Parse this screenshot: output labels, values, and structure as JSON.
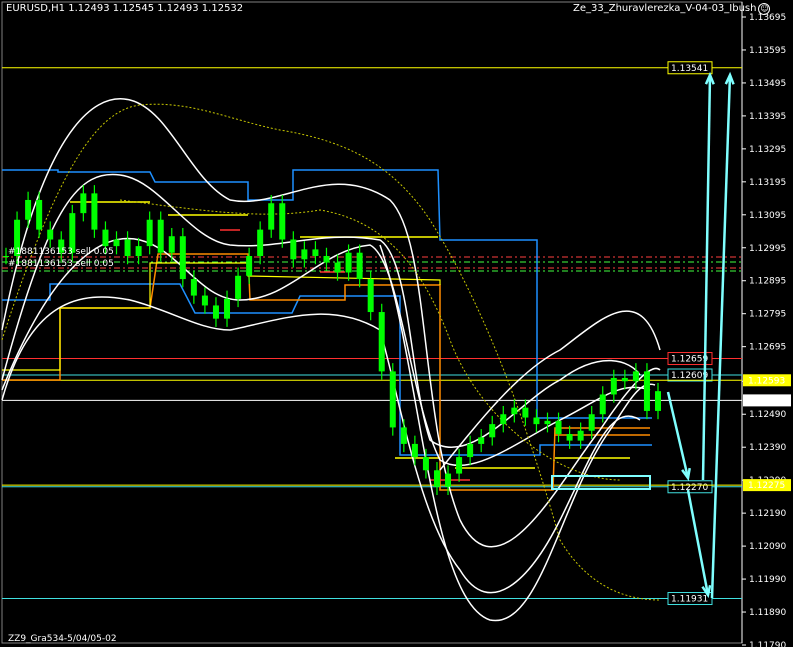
{
  "header": {
    "symbol": "EURUSD,H1",
    "ohlc": "1.12493 1.12545 1.12493 1.12532",
    "expert": "Ze_33_Zhuravlerezka_V-04-03_Ibush",
    "smiley_icon": "smiley-icon"
  },
  "footer": {
    "label": "ZZ9_Gra534-5/04/05-02"
  },
  "orders": [
    {
      "text": "#1881136153 sell 0.05"
    },
    {
      "text": "#1881136153 sell 0.05"
    }
  ],
  "colors": {
    "background": "#000000",
    "candles": "#00ff00",
    "bands": "#ffffff",
    "channel_blue": "#1e90ff",
    "channel_orange": "#ff8c00",
    "yellow": "#ffff00",
    "arrows": "#7fffff",
    "red_level": "#ff3030",
    "grid_cyan": "#40e0e0"
  },
  "chart_data": {
    "type": "line",
    "title": "",
    "price_axis": {
      "ticks": [
        "1.13695",
        "1.13595",
        "1.13495",
        "1.13395",
        "1.13295",
        "1.13195",
        "1.13095",
        "1.12995",
        "1.12895",
        "1.12795",
        "1.12695",
        "1.12590",
        "1.12490",
        "1.12390",
        "1.12290",
        "1.12190",
        "1.12090",
        "1.11990",
        "1.11890",
        "1.11790"
      ],
      "ylim": [
        1.1179,
        1.13695
      ]
    },
    "horizontal_levels": [
      {
        "price": 1.13541,
        "label": "1.13541",
        "color": "#ffff00"
      },
      {
        "price": 1.12659,
        "label": "1.12659",
        "color": "#ff3030"
      },
      {
        "price": 1.12609,
        "label": "1.12609",
        "color": "#40e0e0"
      },
      {
        "price": 1.12593,
        "label": "1.12593",
        "color": "#ffff00",
        "tag": true
      },
      {
        "price": 1.12532,
        "label": "1.12532",
        "color": "#ffffff",
        "tag": true
      },
      {
        "price": 1.1227,
        "label": "1.12270",
        "color": "#40e0e0"
      },
      {
        "price": 1.12275,
        "label": "1.12275",
        "color": "#ffff00",
        "tag": true
      },
      {
        "price": 1.11931,
        "label": "1.11931",
        "color": "#40e0e0"
      }
    ],
    "price_close_path": [
      1.1297,
      1.1308,
      1.1314,
      1.1305,
      1.1302,
      1.1298,
      1.131,
      1.1316,
      1.1305,
      1.13,
      1.1302,
      1.1297,
      1.13,
      1.1308,
      1.1298,
      1.1303,
      1.129,
      1.1285,
      1.1282,
      1.1278,
      1.1284,
      1.1291,
      1.1297,
      1.1305,
      1.1313,
      1.1302,
      1.1296,
      1.1299,
      1.1297,
      1.1295,
      1.1292,
      1.1298,
      1.129,
      1.128,
      1.1262,
      1.1245,
      1.124,
      1.1236,
      1.1232,
      1.1227,
      1.1231,
      1.1236,
      1.124,
      1.1242,
      1.1246,
      1.1249,
      1.1251,
      1.1248,
      1.1246,
      1.1247,
      1.1243,
      1.1241,
      1.1244,
      1.1249,
      1.1255,
      1.126,
      1.1259,
      1.1262,
      1.125,
      1.1256
    ]
  }
}
